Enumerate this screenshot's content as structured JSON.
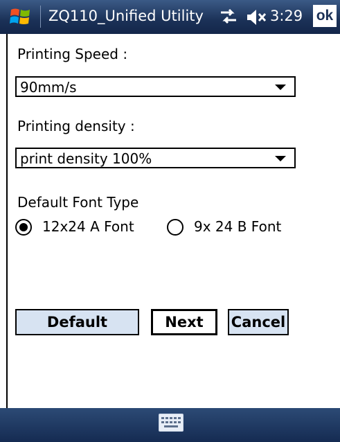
{
  "title_bar": {
    "app_title": "ZQ110_Unified Utility",
    "time": "3:29",
    "ok_label": "ok",
    "icons": [
      "windows-start-icon",
      "connectivity-icon",
      "volume-muted-icon"
    ]
  },
  "form": {
    "speed_label": "Printing Speed :",
    "speed_value": "90mm/s",
    "density_label": "Printing density :",
    "density_value": "print density 100%",
    "font_label": "Default Font Type",
    "font_options": [
      {
        "label": "12x24 A Font",
        "selected": true
      },
      {
        "label": "9x 24 B Font",
        "selected": false
      }
    ]
  },
  "buttons": {
    "default_label": "Default",
    "next_label": "Next",
    "cancel_label": "Cancel"
  },
  "bottom_bar": {
    "icons": [
      "keyboard-icon"
    ]
  },
  "colors": {
    "title_bar": "#1b3157",
    "button_bg": "#d7e3f2"
  }
}
